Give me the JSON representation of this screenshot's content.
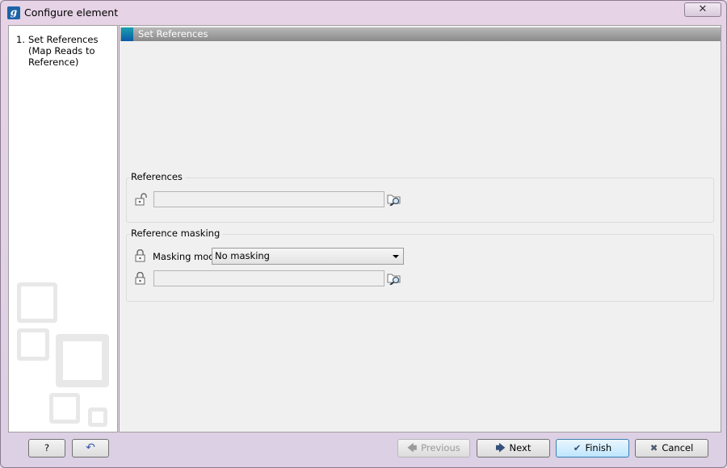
{
  "window": {
    "title": "Configure element",
    "close_label": "✕"
  },
  "steps": [
    {
      "number": "1.",
      "label": "Set References (Map Reads to Reference)"
    }
  ],
  "panel": {
    "header": "Set References"
  },
  "references": {
    "label": "References",
    "value": ""
  },
  "masking": {
    "label": "Reference masking",
    "mode_label": "Masking mode",
    "mode_value": "No masking",
    "file_value": ""
  },
  "buttons": {
    "help": "?",
    "previous": "Previous",
    "next": "Next",
    "finish": "Finish",
    "cancel": "Cancel"
  },
  "colors": {
    "accent": "#0a5aa8",
    "header": "#9a9a9a"
  }
}
